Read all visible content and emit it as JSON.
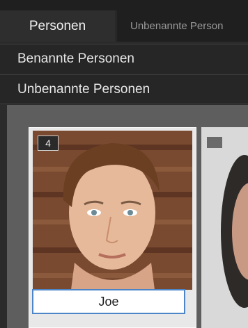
{
  "tabs": [
    {
      "label": "Personen",
      "active": true
    },
    {
      "label": "Unbenannte Person",
      "active": false
    }
  ],
  "sections": {
    "named": "Benannte Personen",
    "unnamed": "Unbenannte Personen"
  },
  "cards": [
    {
      "count": "4",
      "name_value": "Joe"
    },
    {
      "count": "",
      "name_value": ""
    }
  ],
  "colors": {
    "accent": "#4d86c8",
    "background": "#2b2b2b",
    "grid_background": "#5e5e5e"
  }
}
